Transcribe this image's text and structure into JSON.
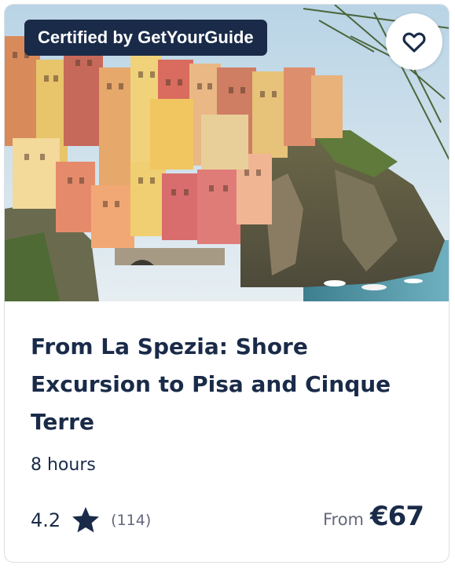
{
  "card": {
    "badge_label": "Certified by GetYourGuide",
    "title": "From La Spezia: Shore Excursion to Pisa and Cinque Terre",
    "duration": "8 hours",
    "rating": "4.2",
    "review_count": "(114)",
    "price_prefix": "From",
    "price": "€67",
    "favorite_icon": "heart-outline-icon",
    "rating_icon": "star-filled-icon"
  },
  "colors": {
    "primary_text": "#1a2b49",
    "secondary_text": "#63687a",
    "badge_bg": "#1a2b49",
    "card_border": "#dcdfe4"
  }
}
